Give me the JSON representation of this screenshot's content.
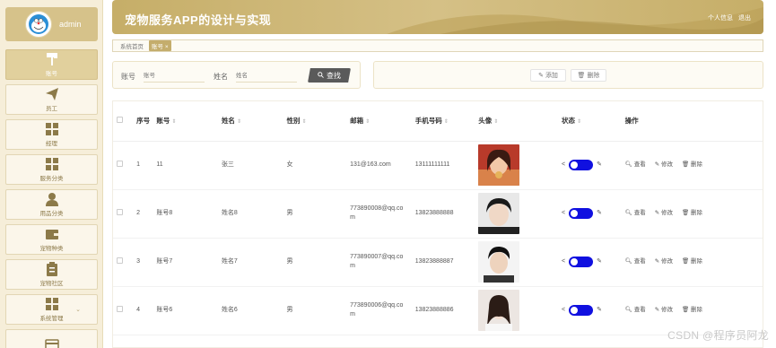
{
  "user": {
    "name": "admin"
  },
  "header": {
    "title": "宠物服务APP的设计与实现",
    "profile_link": "个人信息",
    "logout_link": "退出"
  },
  "breadcrumb": {
    "home": "系统首页",
    "current": "账号",
    "close": "×"
  },
  "sidebar": {
    "items": [
      {
        "label": "账号",
        "icon": "paint-roller-icon"
      },
      {
        "label": "员工",
        "icon": "paper-plane-icon"
      },
      {
        "label": "经理",
        "icon": "grid-icon"
      },
      {
        "label": "服务分类",
        "icon": "grid-icon"
      },
      {
        "label": "用品分类",
        "icon": "person-icon"
      },
      {
        "label": "宠物种类",
        "icon": "wallet-icon"
      },
      {
        "label": "宠物社区",
        "icon": "clipboard-icon"
      },
      {
        "label": "系统管理",
        "icon": "grid-icon"
      }
    ]
  },
  "search": {
    "account_label": "账号",
    "account_placeholder": "账号",
    "name_label": "姓名",
    "name_placeholder": "姓名",
    "button": "查找"
  },
  "actions": {
    "add": "添加",
    "delete": "删除"
  },
  "table": {
    "headers": [
      "序号",
      "账号",
      "姓名",
      "性别",
      "邮箱",
      "手机号码",
      "头像",
      "状态",
      "操作"
    ],
    "rows": [
      {
        "index": "1",
        "account": "11",
        "name": "张三",
        "gender": "女",
        "email": "131@163.com",
        "phone": "13111111111"
      },
      {
        "index": "2",
        "account": "账号8",
        "name": "姓名8",
        "gender": "男",
        "email": "773890008@qq.com",
        "phone": "13823888888"
      },
      {
        "index": "3",
        "account": "账号7",
        "name": "姓名7",
        "gender": "男",
        "email": "773890007@qq.com",
        "phone": "13823888887"
      },
      {
        "index": "4",
        "account": "账号6",
        "name": "姓名6",
        "gender": "男",
        "email": "773890006@qq.com",
        "phone": "13823888886"
      }
    ],
    "ops": {
      "view": "查看",
      "edit": "修改",
      "delete": "删除"
    }
  },
  "colors": {
    "accent": "#c6ae68",
    "toggle_on": "#1010e0",
    "search_button": "#5a5a5a"
  },
  "watermark": "CSDN @程序员阿龙"
}
